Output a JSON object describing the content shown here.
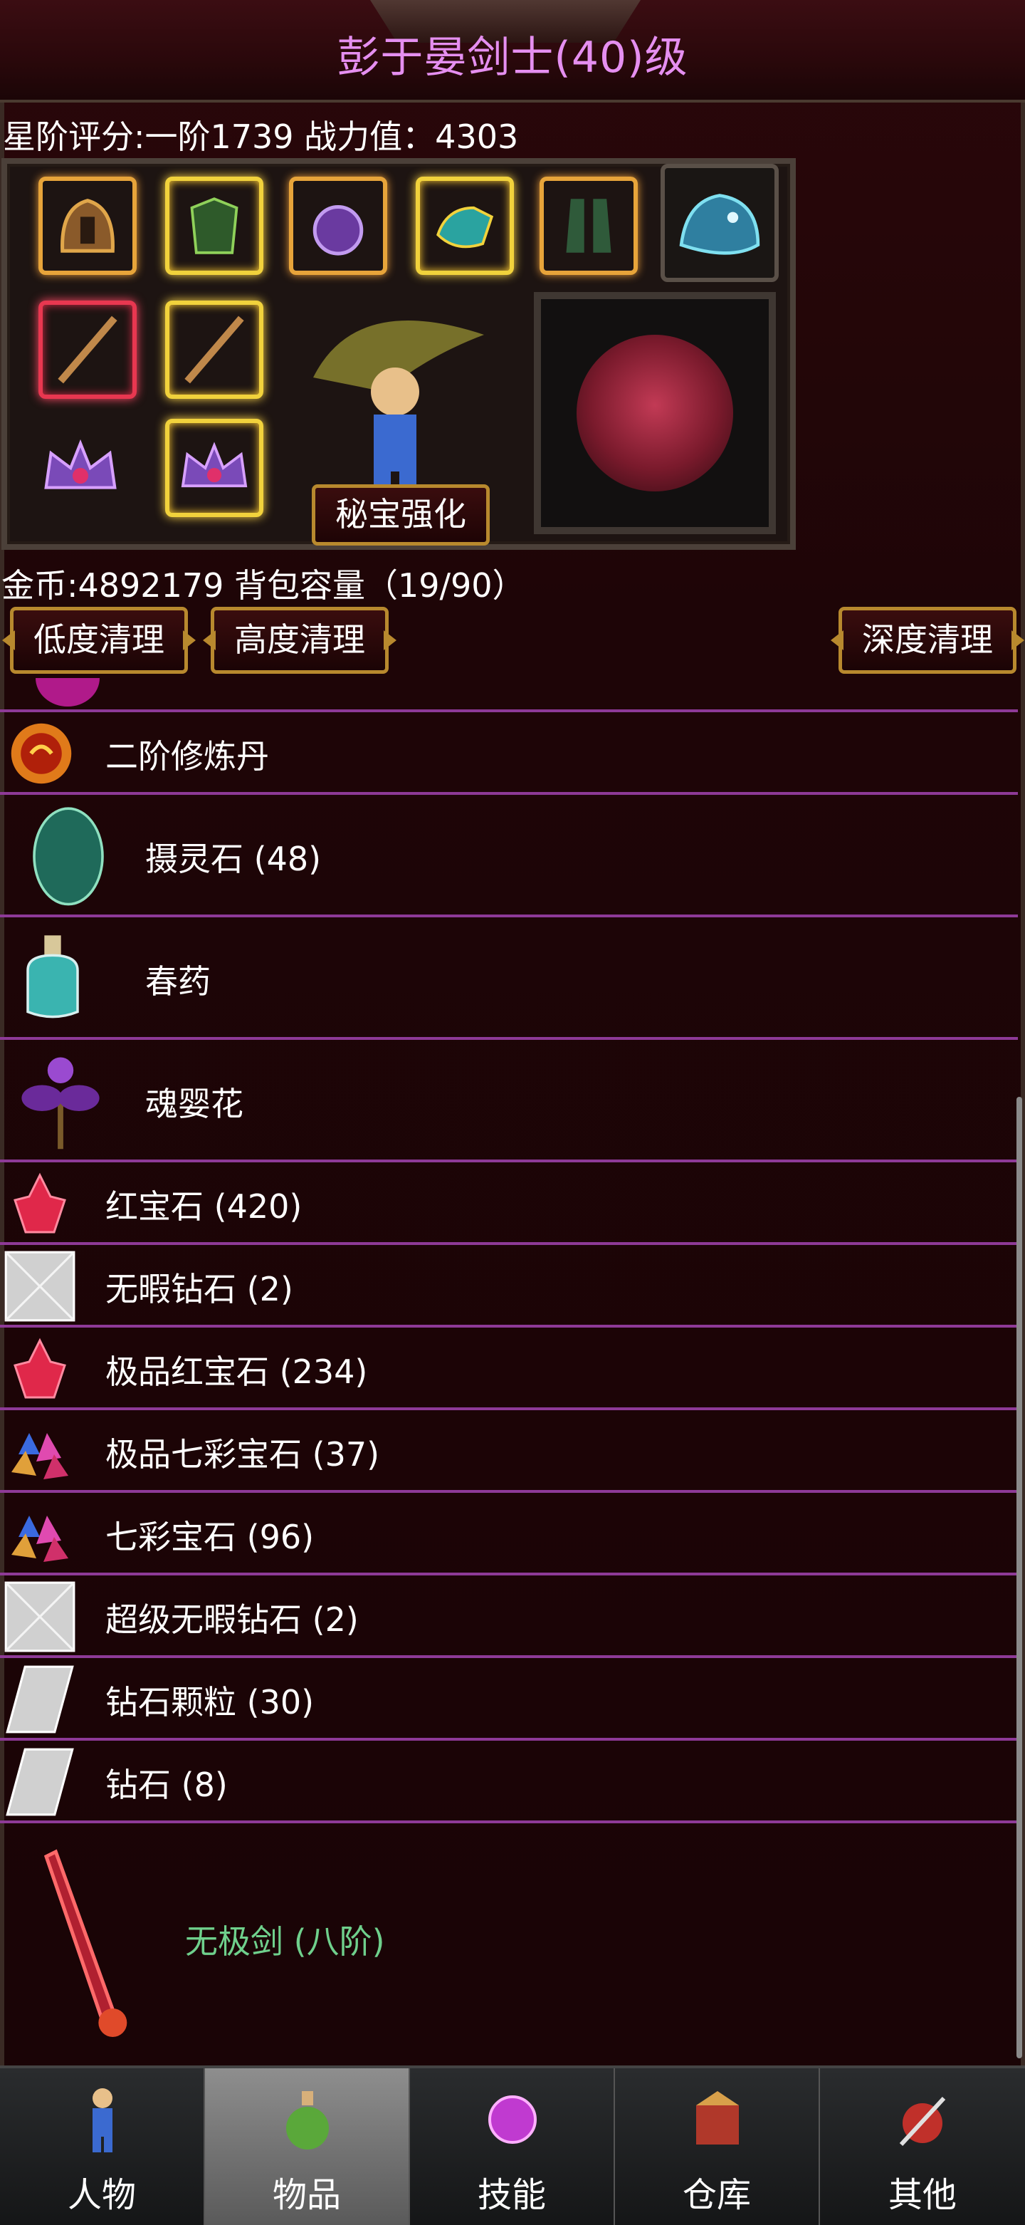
{
  "header": {
    "title": "彭于晏剑士(40)级",
    "stats": "星阶评分:一阶1739 战力值：4303"
  },
  "equipment": {
    "treasure_button": "秘宝强化"
  },
  "inventory": {
    "gold_capacity": "金币:4892179 背包容量（19/90）",
    "buttons": {
      "low_clean": "低度清理",
      "high_clean": "高度清理",
      "deep_clean": "深度清理"
    },
    "items": [
      {
        "name": "二阶修炼丹"
      },
      {
        "name": "摄灵石 (48)"
      },
      {
        "name": "春药"
      },
      {
        "name": "魂婴花"
      },
      {
        "name": "红宝石 (420)"
      },
      {
        "name": "无暇钻石 (2)"
      },
      {
        "name": "极品红宝石 (234)"
      },
      {
        "name": "极品七彩宝石 (37)"
      },
      {
        "name": "七彩宝石 (96)"
      },
      {
        "name": "超级无暇钻石 (2)"
      },
      {
        "name": "钻石颗粒 (30)"
      },
      {
        "name": "钻石 (8)"
      },
      {
        "name": "无极剑 (八阶)"
      }
    ]
  },
  "tabs": [
    {
      "label": "人物"
    },
    {
      "label": "物品"
    },
    {
      "label": "技能"
    },
    {
      "label": "仓库"
    },
    {
      "label": "其他"
    }
  ],
  "colors": {
    "title": "#e58ff0",
    "divider": "#8e3a97",
    "legendary_item": "#6fd08c",
    "gold_frame": "#f1d23c",
    "red_frame": "#e83750"
  }
}
